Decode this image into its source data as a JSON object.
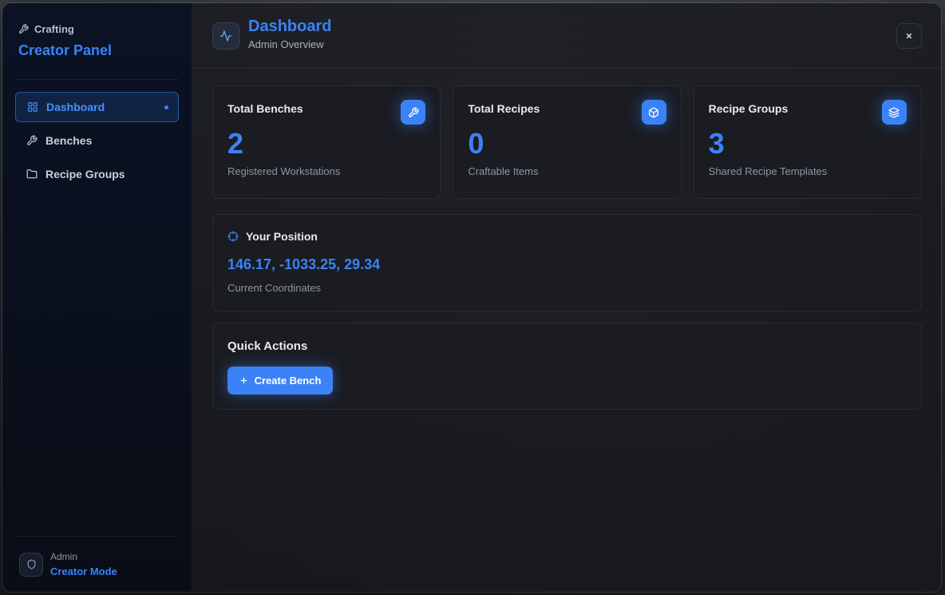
{
  "sidebar": {
    "brand_label": "Crafting",
    "brand_title": "Creator Panel",
    "items": [
      {
        "label": "Dashboard",
        "icon": "grid-icon",
        "active": true
      },
      {
        "label": "Benches",
        "icon": "wrench-icon",
        "active": false
      },
      {
        "label": "Recipe Groups",
        "icon": "folder-icon",
        "active": false
      }
    ],
    "footer": {
      "role": "Admin",
      "mode": "Creator Mode",
      "icon": "shield-icon"
    }
  },
  "header": {
    "title": "Dashboard",
    "subtitle": "Admin Overview",
    "icon": "activity-icon",
    "close_icon": "close-icon"
  },
  "stats": [
    {
      "title": "Total Benches",
      "value": "2",
      "subtitle": "Registered Workstations",
      "icon": "wrench-icon"
    },
    {
      "title": "Total Recipes",
      "value": "0",
      "subtitle": "Craftable Items",
      "icon": "cube-icon"
    },
    {
      "title": "Recipe Groups",
      "value": "3",
      "subtitle": "Shared Recipe Templates",
      "icon": "layers-icon"
    }
  ],
  "position": {
    "title": "Your Position",
    "coords": "146.17, -1033.25, 29.34",
    "subtitle": "Current Coordinates",
    "icon": "crosshair-icon"
  },
  "quick_actions": {
    "title": "Quick Actions",
    "create_bench_label": "Create Bench"
  },
  "colors": {
    "accent": "#3b82f6",
    "sidebar_bg": "#0a1224",
    "main_bg": "#16171c"
  }
}
